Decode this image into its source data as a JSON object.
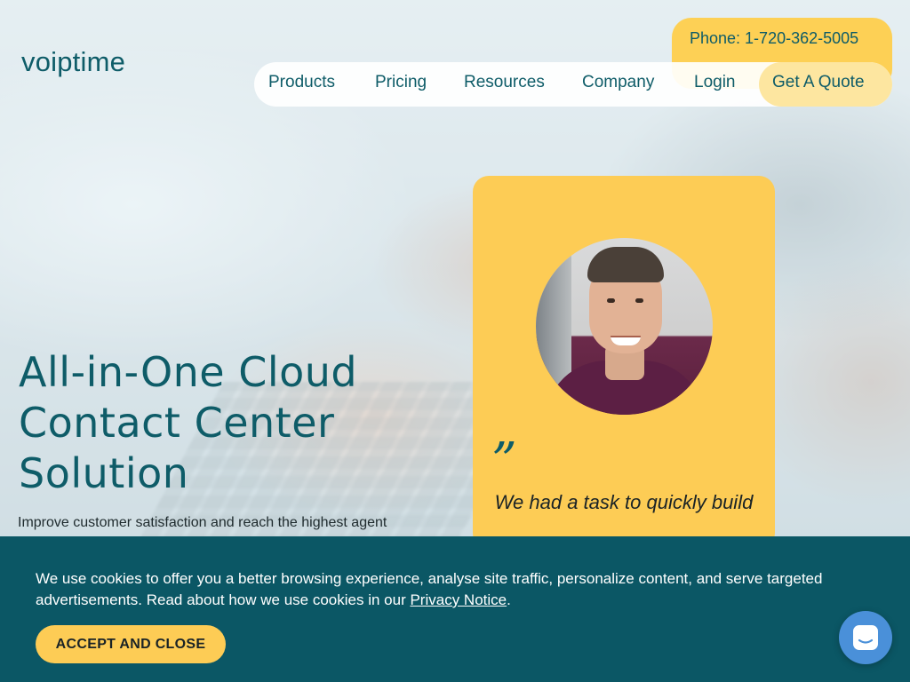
{
  "brand": {
    "logo_text": "voiptime"
  },
  "header": {
    "phone": "Phone: 1-720-362-5005",
    "nav": [
      {
        "label": "Products"
      },
      {
        "label": "Pricing"
      },
      {
        "label": "Resources"
      },
      {
        "label": "Company"
      },
      {
        "label": "Login"
      }
    ],
    "quote_button": "Get A Quote"
  },
  "hero": {
    "title_lines": [
      "All-in-One Cloud",
      "Contact Center",
      "Solution"
    ],
    "subtitle": "Improve customer satisfaction and reach the highest agent"
  },
  "testimonial": {
    "quote_mark": "”",
    "text": "We had a task to quickly build"
  },
  "cookie_banner": {
    "text_before_link": "We use cookies to offer you a better browsing experience, analyse site traffic, personalize content, and serve targeted advertisements. Read about how we use cookies in our ",
    "link_text": "Privacy Notice",
    "text_after_link": ".",
    "accept_label": "ACCEPT AND CLOSE"
  },
  "colors": {
    "brand_teal": "#0e5c68",
    "accent_yellow": "#fdcc55",
    "banner_teal": "#0b5765",
    "chat_blue": "#4a90d9"
  },
  "icons": {
    "chat": "chat-bubble-icon"
  }
}
